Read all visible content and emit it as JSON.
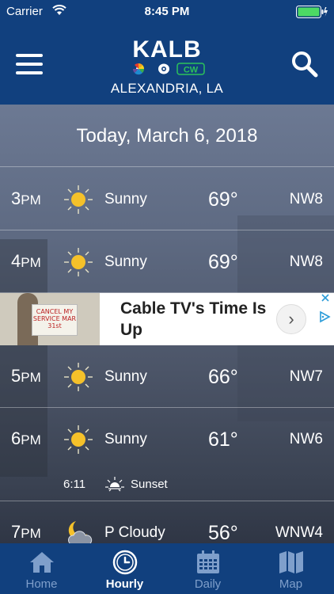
{
  "status_bar": {
    "carrier": "Carrier",
    "time": "8:45 PM"
  },
  "header": {
    "logo_text": "KALB",
    "logo_sub": "CW",
    "location": "ALEXANDRIA, LA"
  },
  "date_heading": "Today, March 6, 2018",
  "hours": [
    {
      "hour": "3",
      "ampm": "PM",
      "icon": "sun-icon",
      "condition": "Sunny",
      "temp": "69°",
      "wind": "NW8"
    },
    {
      "hour": "4",
      "ampm": "PM",
      "icon": "sun-icon",
      "condition": "Sunny",
      "temp": "69°",
      "wind": "NW8"
    },
    {
      "hour": "5",
      "ampm": "PM",
      "icon": "sun-icon",
      "condition": "Sunny",
      "temp": "66°",
      "wind": "NW7"
    },
    {
      "hour": "6",
      "ampm": "PM",
      "icon": "sun-icon",
      "condition": "Sunny",
      "temp": "61°",
      "wind": "NW6"
    },
    {
      "hour": "7",
      "ampm": "PM",
      "icon": "moon-cloud-icon",
      "condition": "P Cloudy",
      "temp": "56°",
      "wind": "WNW4"
    }
  ],
  "sunset": {
    "time": "6:11",
    "label": "Sunset",
    "icon": "sunset-icon"
  },
  "ad": {
    "headline": "Cable TV's Time Is Up",
    "sign_text": "CANCEL MY SERVICE MAR 31st",
    "arrow": "›"
  },
  "tabs": [
    {
      "label": "Home",
      "icon": "home-icon",
      "active": false
    },
    {
      "label": "Hourly",
      "icon": "clock-icon",
      "active": true
    },
    {
      "label": "Daily",
      "icon": "calendar-icon",
      "active": false
    },
    {
      "label": "Map",
      "icon": "map-icon",
      "active": false
    }
  ],
  "colors": {
    "header_bg": "#11407e",
    "tab_inactive": "#7f9fcb",
    "sun": "#f5c12a"
  }
}
